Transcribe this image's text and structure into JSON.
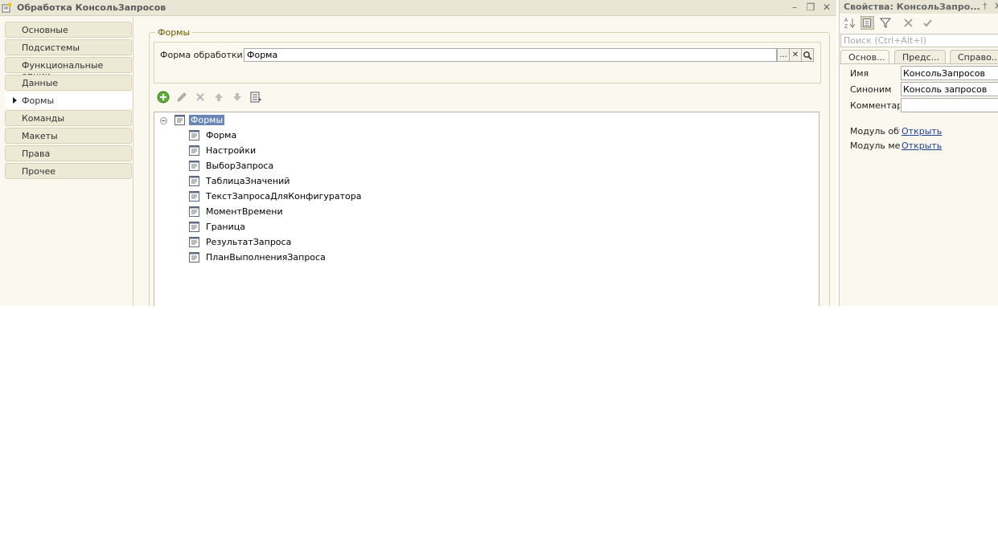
{
  "window": {
    "title": "Обработка КонсольЗапросов"
  },
  "nav": {
    "items": [
      {
        "label": "Основные"
      },
      {
        "label": "Подсистемы"
      },
      {
        "label": "Функциональные опции"
      },
      {
        "label": "Данные"
      },
      {
        "label": "Формы"
      },
      {
        "label": "Команды"
      },
      {
        "label": "Макеты"
      },
      {
        "label": "Права"
      },
      {
        "label": "Прочее"
      }
    ],
    "active": "Формы"
  },
  "forms_group": {
    "title": "Формы",
    "field_label": "Форма обработки:",
    "field_value": "Форма"
  },
  "tree": {
    "root": "Формы",
    "items": [
      "Форма",
      "Настройки",
      "ВыборЗапроса",
      "ТаблицаЗначений",
      "ТекстЗапросаДляКонфигуратора",
      "МоментВремени",
      "Граница",
      "РезультатЗапроса",
      "ПланВыполненияЗапроса"
    ]
  },
  "properties": {
    "title": "Свойства: КонсольЗапро...",
    "search_placeholder": "Поиск (Ctrl+Alt+I)",
    "tabs": [
      "Основ...",
      "Предс...",
      "Справо..."
    ],
    "name_label": "Имя",
    "name_value": "КонсольЗапросов",
    "synonym_label": "Синоним",
    "synonym_value": "Консоль запросов",
    "comment_label": "Комментарий",
    "comment_value": "",
    "object_module_label": "Модуль объекта:",
    "object_module_link": "Открыть",
    "manager_module_label": "Модуль менеджера:",
    "manager_module_link": "Открыть"
  },
  "colors": {
    "background": "#fbf9ef",
    "selection": "#6a86b6",
    "group_title": "#6b5b00",
    "link": "#1a3f8f"
  }
}
